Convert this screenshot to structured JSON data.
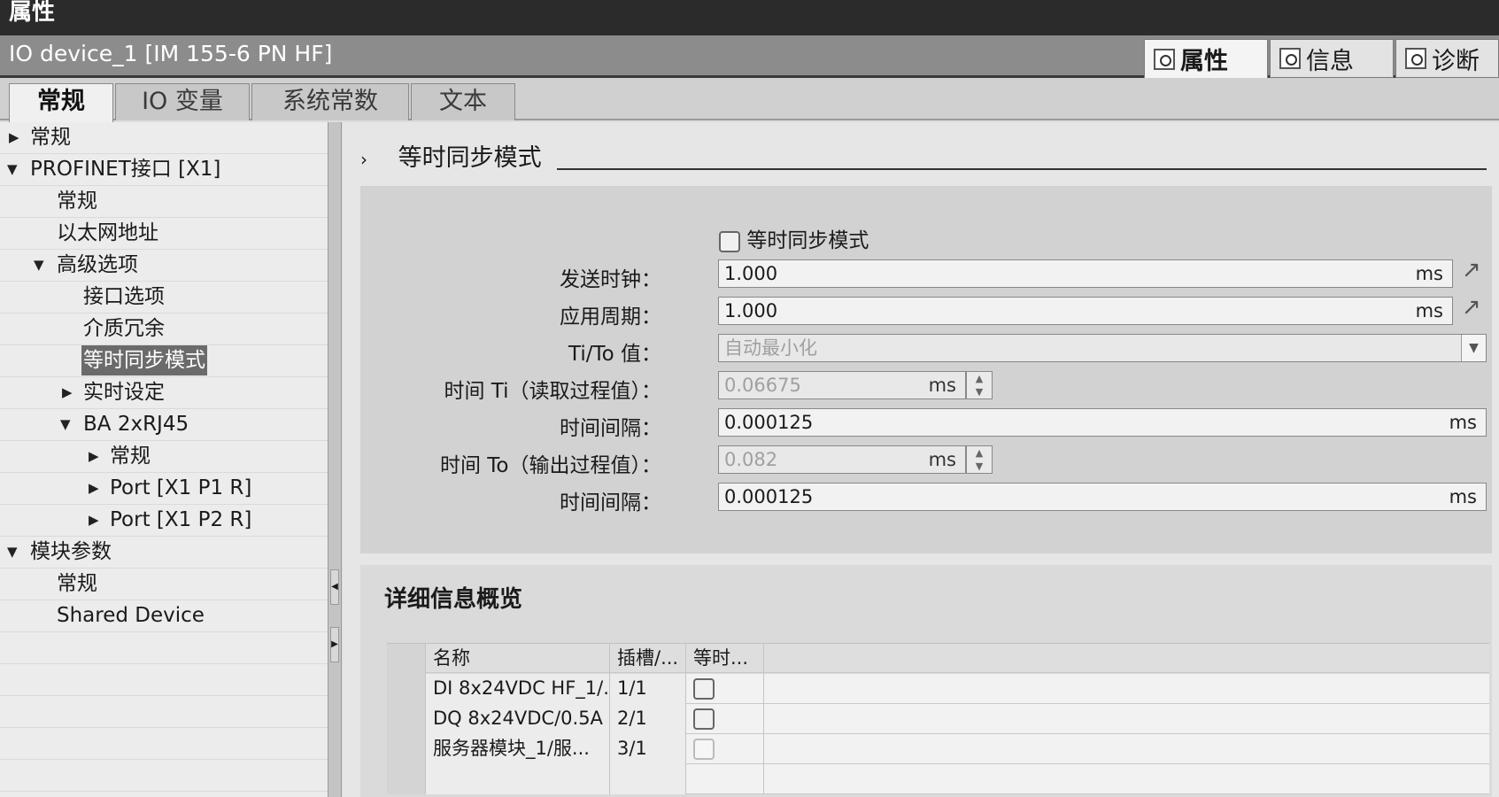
{
  "window": {
    "title": "属性"
  },
  "device": {
    "title": "IO device_1 [IM 155-6 PN HF]"
  },
  "inspector_tabs": [
    {
      "label": "属性",
      "icon": "properties-icon"
    },
    {
      "label": "信息",
      "icon": "info-icon"
    },
    {
      "label": "诊断",
      "icon": "diagnostics-icon"
    }
  ],
  "property_tabs": [
    {
      "label": "常规"
    },
    {
      "label": "IO 变量"
    },
    {
      "label": "系统常数"
    },
    {
      "label": "文本"
    }
  ],
  "nav": [
    {
      "label": "常规"
    },
    {
      "label": "PROFINET接口 [X1]"
    },
    {
      "label": "常规"
    },
    {
      "label": "以太网地址"
    },
    {
      "label": "高级选项"
    },
    {
      "label": "接口选项"
    },
    {
      "label": "介质冗余"
    },
    {
      "label": "等时同步模式"
    },
    {
      "label": "实时设定"
    },
    {
      "label": "BA 2xRJ45"
    },
    {
      "label": "常规"
    },
    {
      "label": "Port [X1 P1 R]"
    },
    {
      "label": "Port [X1 P2 R]"
    },
    {
      "label": "模块参数"
    },
    {
      "label": "常规"
    },
    {
      "label": "Shared Device"
    }
  ],
  "section": {
    "chevron": "›",
    "title": "等时同步模式"
  },
  "params": {
    "iso_checkbox_label": "等时同步模式",
    "send_clock": {
      "label": "发送时钟：",
      "value": "1.000",
      "unit": "ms"
    },
    "app_cycle": {
      "label": "应用周期：",
      "value": "1.000",
      "unit": "ms"
    },
    "tito": {
      "label": "Ti/To 值：",
      "value": "自动最小化"
    },
    "ti": {
      "label": "时间 Ti（读取过程值）：",
      "value": "0.06675",
      "unit": "ms"
    },
    "ti_interval": {
      "label": "时间间隔：",
      "value": "0.000125",
      "unit": "ms"
    },
    "to": {
      "label": "时间 To（输出过程值）：",
      "value": "0.082",
      "unit": "ms"
    },
    "to_interval": {
      "label": "时间间隔：",
      "value": "0.000125",
      "unit": "ms"
    }
  },
  "details": {
    "title": "详细信息概览",
    "columns": [
      "名称",
      "插槽/...",
      "等时..."
    ],
    "rows": [
      {
        "name": "DI 8x24VDC HF_1/...",
        "slot": "1/1"
      },
      {
        "name": "DQ 8x24VDC/0.5A ...",
        "slot": "2/1"
      },
      {
        "name": "服务器模块_1/服...",
        "slot": "3/1"
      }
    ]
  }
}
